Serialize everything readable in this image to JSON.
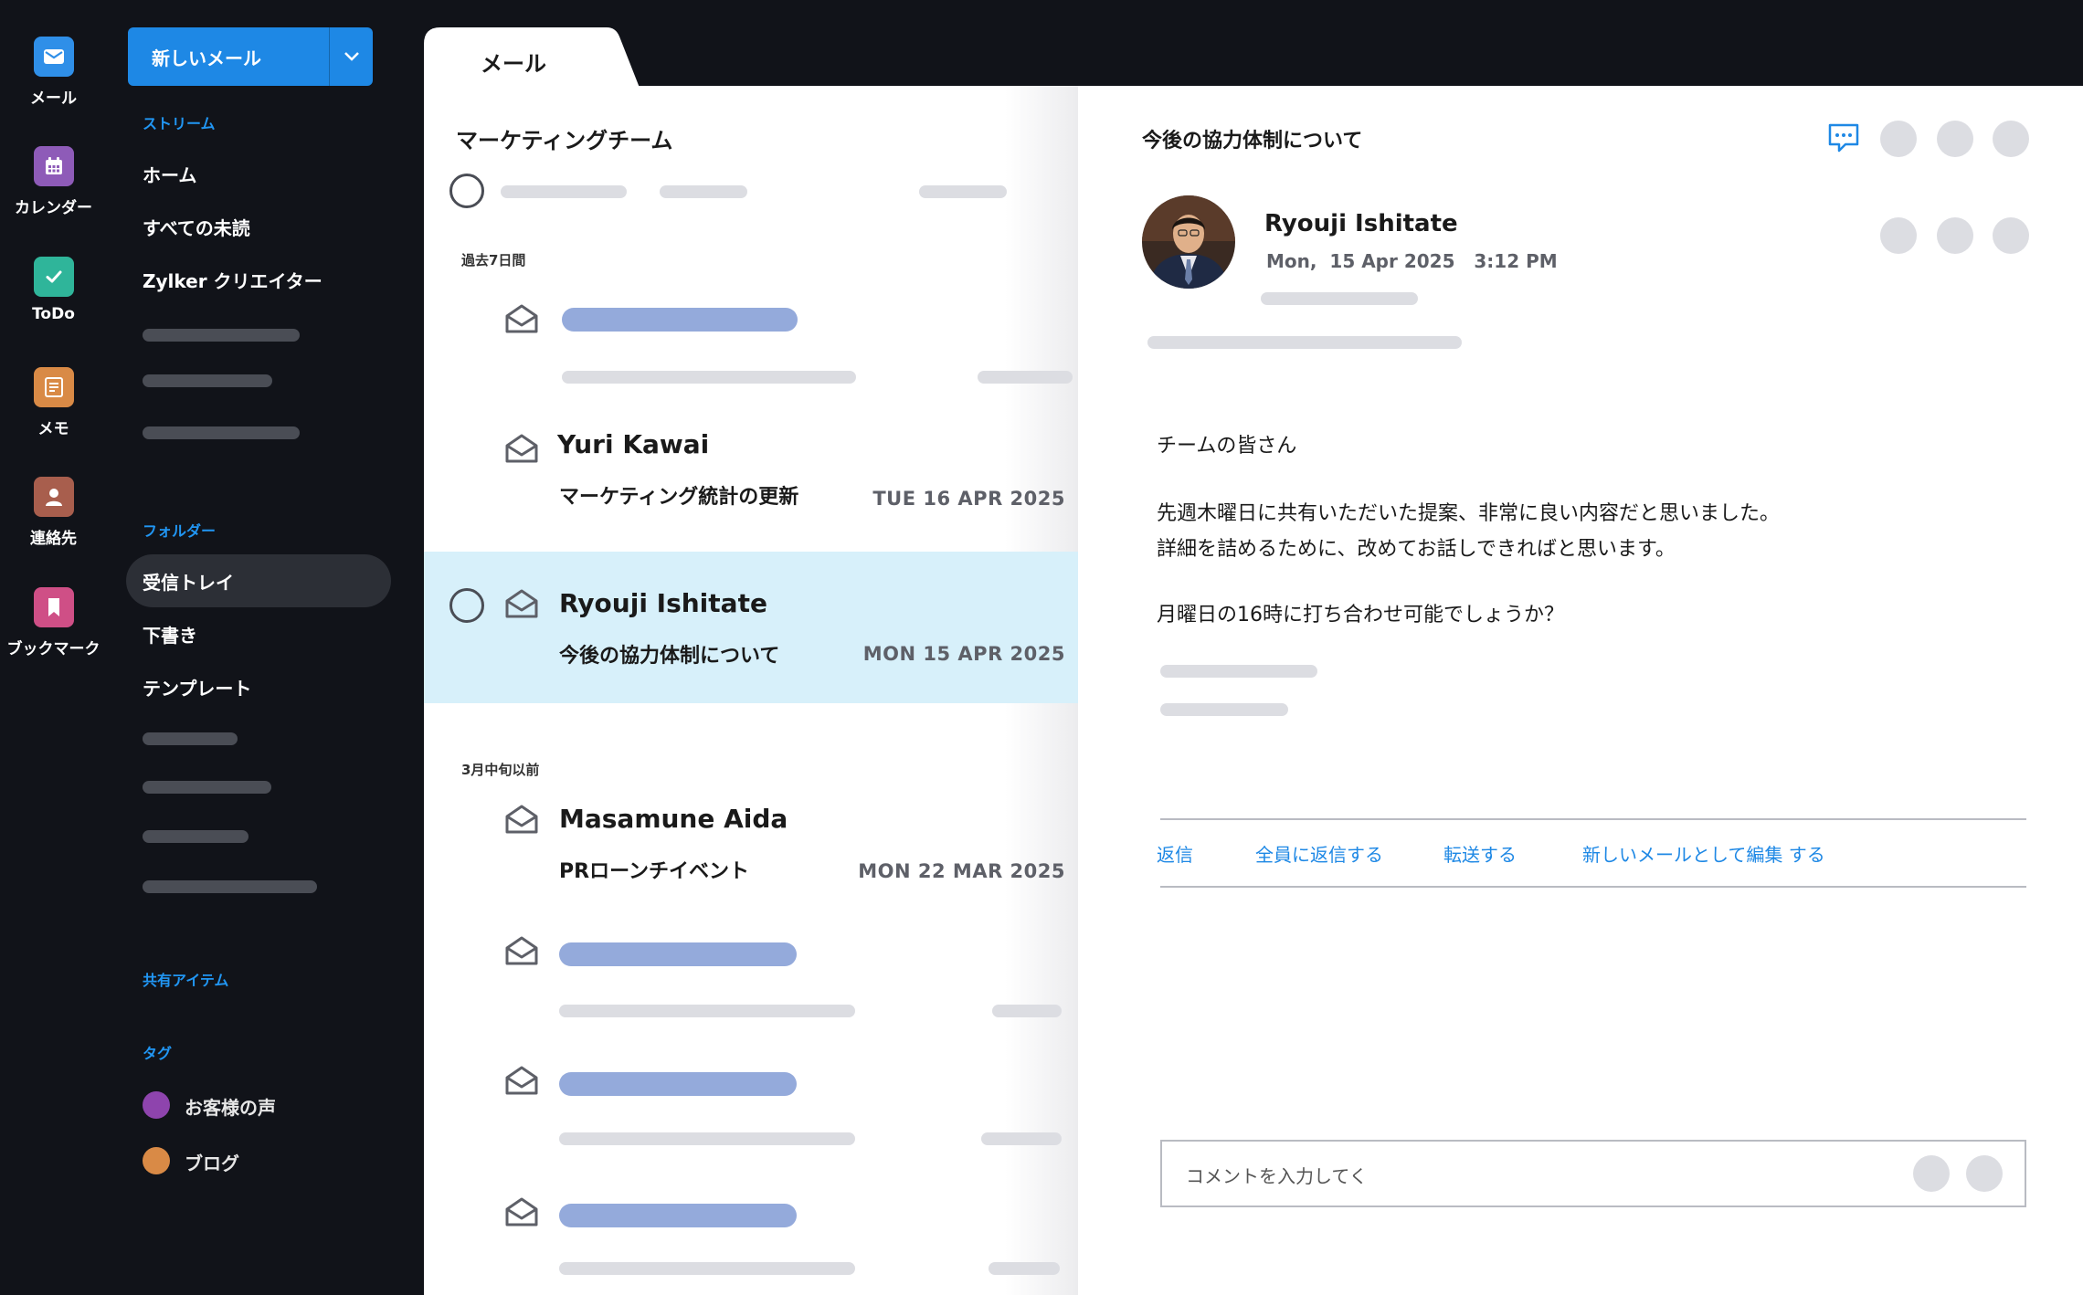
{
  "rail": {
    "items": [
      {
        "label": "メール",
        "color": "#2f8fe8",
        "icon": "mail-icon"
      },
      {
        "label": "カレンダー",
        "color": "#8e5bb8",
        "icon": "calendar-icon"
      },
      {
        "label": "ToDo",
        "color": "#2fb59a",
        "icon": "check-icon"
      },
      {
        "label": "メモ",
        "color": "#d98a46",
        "icon": "note-icon"
      },
      {
        "label": "連絡先",
        "color": "#a85e4d",
        "icon": "contact-icon"
      },
      {
        "label": "ブックマーク",
        "color": "#cf4f86",
        "icon": "bookmark-icon"
      }
    ]
  },
  "sidebar": {
    "new_mail_label": "新しいメール",
    "stream_heading": "ストリーム",
    "stream_items": [
      "ホーム",
      "すべての未読",
      "Zylker クリエイター"
    ],
    "folders_heading": "フォルダー",
    "folder_items": [
      "受信トレイ",
      "下書き",
      "テンプレート"
    ],
    "shared_heading": "共有アイテム",
    "tags_heading": "タグ",
    "tags": [
      {
        "label": "お客様の声",
        "color": "#8e44ad"
      },
      {
        "label": "ブログ",
        "color": "#d98a46"
      }
    ]
  },
  "tab": {
    "label": "メール"
  },
  "list": {
    "title": "マーケティングチーム",
    "group1_label": "過去7日間",
    "group2_label": "3月中旬以前",
    "messages": [
      {
        "sender": "Yuri Kawai",
        "subject": "マーケティング統計の更新",
        "date": "TUE 16 APR 2025"
      },
      {
        "sender": "Ryouji Ishitate",
        "subject": "今後の協力体制について",
        "date": "MON 15 APR 2025"
      },
      {
        "sender": "Masamune Aida",
        "subject": "PRローンチイベント",
        "date": "MON 22 MAR 2025"
      }
    ]
  },
  "reader": {
    "subject": "今後の協力体制について",
    "from_name": "Ryouji Ishitate",
    "from_date": "Mon,  15 Apr 2025   3:12 PM",
    "body": [
      "チームの皆さん",
      "先週木曜日に共有いただいた提案、非常に良い内容だと思いました。",
      "詳細を詰めるために、改めてお話しできればと思います。",
      "月曜日の16時に打ち合わせ可能でしょうか？"
    ],
    "actions": [
      "返信",
      "全員に返信する",
      "転送する",
      "新しいメールとして編集 する"
    ],
    "comment_placeholder": "コメントを入力してく"
  }
}
